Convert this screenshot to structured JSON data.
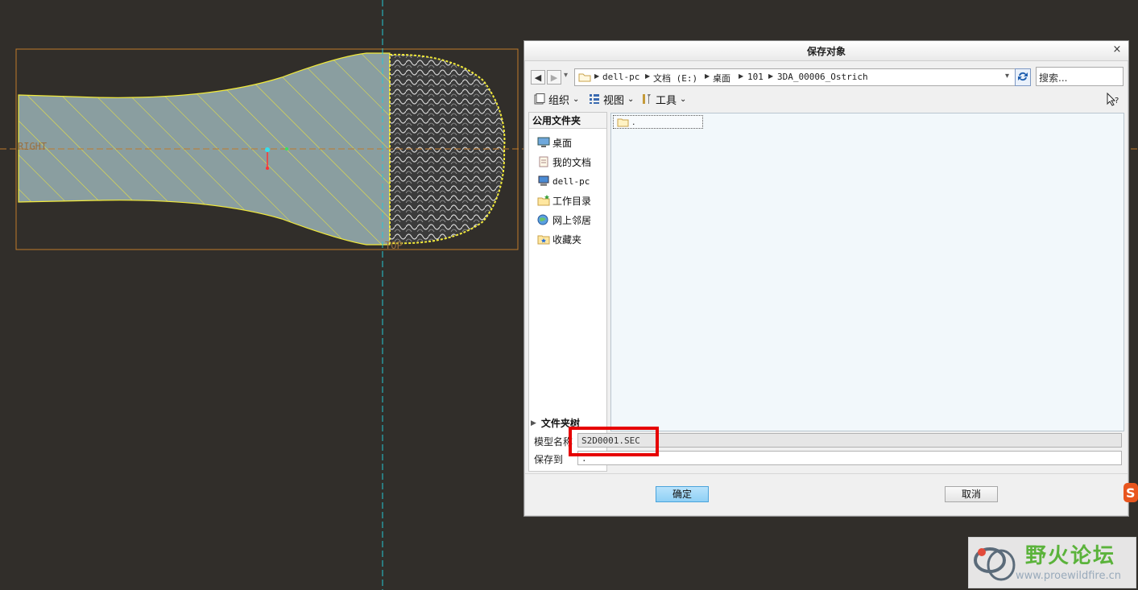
{
  "canvas": {
    "label_right": "RIGHT",
    "label_top": "TOP"
  },
  "dialog": {
    "title": "保存对象",
    "close_glyph": "×",
    "nav": {
      "back_glyph": "◀",
      "forward_glyph": "▶",
      "dropdown_glyph": "▾"
    },
    "address_segments": [
      "dell-pc",
      "文档 (E:)",
      "桌面",
      "101",
      "3DA_00006_Ostrich"
    ],
    "search_placeholder": "搜索...",
    "toolbar": {
      "organize_label": "组织",
      "view_label": "视图",
      "tools_label": "工具"
    },
    "left_panel": {
      "header": "公用文件夹",
      "items": [
        {
          "label": "桌面",
          "icon": "desktop-icon"
        },
        {
          "label": "我的文档",
          "icon": "my-documents-icon"
        },
        {
          "label": "dell-pc",
          "icon": "computer-icon"
        },
        {
          "label": "工作目录",
          "icon": "working-directory-icon"
        },
        {
          "label": "网上邻居",
          "icon": "network-icon"
        },
        {
          "label": "收藏夹",
          "icon": "favorites-icon"
        }
      ],
      "tree_toggle_label": "文件夹树"
    },
    "file_list": {
      "items": [
        {
          "name": ".",
          "icon": "folder-icon"
        }
      ]
    },
    "model_name": {
      "label": "模型名称",
      "value": "S2D0001.SEC"
    },
    "save_to": {
      "label": "保存到",
      "value": "."
    },
    "ok_label": "确定",
    "cancel_label": "取消"
  },
  "watermark": {
    "title": "野火论坛",
    "url": "www.proewildfire.cn"
  },
  "colors": {
    "background": "#312e2a",
    "highlight": "#e60000",
    "ok_button": "#8fd0f5",
    "watermark_green": "#5bb33b"
  }
}
